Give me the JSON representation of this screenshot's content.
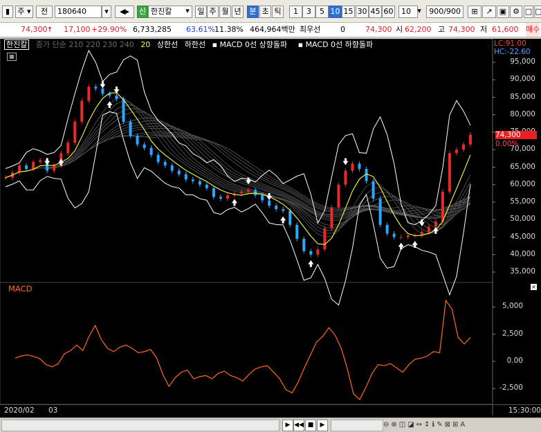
{
  "toolbar": {
    "market": "주",
    "prev": "전",
    "code": "180640",
    "badge": "신",
    "stock_name": "한진칼",
    "periods": [
      "일",
      "주",
      "월",
      "년",
      "분",
      "초",
      "틱"
    ],
    "selected_period": "분",
    "intervals": [
      "1",
      "3",
      "5",
      "10",
      "15",
      "30",
      "45",
      "60"
    ],
    "selected_interval": "10",
    "interval_select": "10",
    "count": "900/900"
  },
  "quote": {
    "price": "74,300",
    "change": "17,100",
    "change_pct": "+29.90%",
    "volume": "6,733,285",
    "pct1": "63.61%",
    "pct2": "11.38%",
    "amount": "464,964백만",
    "ref_label": "최우선",
    "ref_value": "0",
    "open_value": "74,300",
    "open_label": "시",
    "open_price": "62,200",
    "high_label": "고",
    "high_price": "74,300",
    "low_label": "저",
    "low_price": "61,600",
    "extra": "매수"
  },
  "legend": {
    "name": "한진칼",
    "ma": "종가 단순 210 220 230 240",
    "ma_last": "20",
    "upper": "상한선",
    "lower": "하한선",
    "macd_up": "MACD 0선 상향돌파",
    "macd_down": "MACD 0선 하향돌파"
  },
  "price_axis": {
    "labels": [
      "95,000",
      "90,000",
      "85,000",
      "80,000",
      "75,000",
      "70,000",
      "65,000",
      "60,000",
      "55,000",
      "50,000",
      "45,000",
      "40,000",
      "35,000"
    ],
    "lc": "LC:91.00",
    "hc": "HC:-22.60",
    "current_price": "74,300",
    "current_pct": "0.00%"
  },
  "macd_panel": {
    "title": "MACD",
    "labels": [
      "5,000",
      "2,500",
      "0.00",
      "-2,500"
    ]
  },
  "time_axis": {
    "start": "2020/02",
    "mid": "03",
    "end_time": "15:30:00"
  },
  "colors": {
    "up": "#e82a2a",
    "down": "#2aa8ff",
    "macd": "#ff6a1a",
    "ma": "#ffff40",
    "band": "#ffffff",
    "accent": "#2f6fd6"
  },
  "chart_data": [
    {
      "type": "line",
      "title": "",
      "xlabel": "",
      "ylabel": "",
      "x": [
        "2020/02",
        "03"
      ],
      "ylim": [
        35000,
        97000
      ],
      "series": [
        {
          "values": [
            62000,
            63500,
            65500,
            64500,
            66500,
            67000,
            64000,
            65500,
            69000,
            72000,
            78000,
            84000,
            88000,
            87500,
            86000,
            85500,
            84500,
            78000,
            74000,
            71500,
            70500,
            68500,
            66500,
            65500,
            64000,
            63000,
            61500,
            61000,
            60000,
            59000,
            56500,
            56000,
            57000,
            57500,
            58000,
            58500,
            57000,
            55500,
            54000,
            53000,
            52500,
            48500,
            44500,
            41000,
            40000,
            41500,
            47500,
            53500,
            60000,
            64000,
            66000,
            64500,
            61000,
            56000,
            48500,
            46000,
            45000,
            45000,
            45500,
            45500,
            46500,
            48000,
            49500,
            58000,
            69000,
            70000,
            71500,
            74300
          ]
        }
      ]
    },
    {
      "type": "line",
      "title": "MACD",
      "ylim": [
        -3500,
        6200
      ],
      "series": [
        {
          "name": "MACD",
          "values": [
            300,
            500,
            600,
            450,
            250,
            -300,
            -500,
            -200,
            700,
            1000,
            1500,
            1000,
            2300,
            3300,
            2000,
            1200,
            900,
            1300,
            1500,
            1200,
            800,
            900,
            1100,
            300,
            -1200,
            -2300,
            -1500,
            -1000,
            -800,
            -1600,
            -1400,
            -1300,
            -1600,
            -1100,
            -900,
            -1300,
            -1500,
            -1800,
            -1200,
            -700,
            -500,
            -400,
            -1000,
            -1600,
            -2600,
            -2900,
            -1900,
            -600,
            600,
            1800,
            2300,
            3100,
            2400,
            1200,
            -700,
            -3000,
            -3500,
            -2400,
            -1100,
            -300,
            -400,
            -200,
            -600,
            -1000,
            -300,
            200,
            300,
            500,
            900,
            800,
            5600,
            4800,
            2200,
            1600,
            2200
          ]
        }
      ]
    }
  ]
}
